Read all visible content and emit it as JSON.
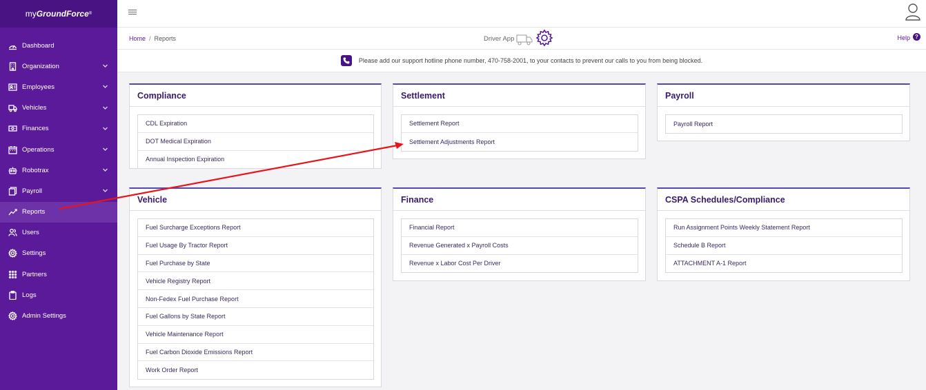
{
  "brand": {
    "part1": "my",
    "part2": "GroundForce",
    "mark": "®"
  },
  "sidebar": {
    "items": [
      {
        "label": "Dashboard",
        "icon": "dashboard-icon",
        "chevron": false
      },
      {
        "label": "Organization",
        "icon": "building-icon",
        "chevron": true
      },
      {
        "label": "Employees",
        "icon": "id-card-icon",
        "chevron": true
      },
      {
        "label": "Vehicles",
        "icon": "truck-icon",
        "chevron": true
      },
      {
        "label": "Finances",
        "icon": "money-icon",
        "chevron": true
      },
      {
        "label": "Operations",
        "icon": "calendar-icon",
        "chevron": true
      },
      {
        "label": "Robotrax",
        "icon": "robot-icon",
        "chevron": true
      },
      {
        "label": "Payroll",
        "icon": "payroll-icon",
        "chevron": true
      },
      {
        "label": "Reports",
        "icon": "chart-icon",
        "chevron": false,
        "active": true
      },
      {
        "label": "Users",
        "icon": "users-icon",
        "chevron": false
      },
      {
        "label": "Settings",
        "icon": "gear-icon",
        "chevron": false
      },
      {
        "label": "Partners",
        "icon": "grid-icon",
        "chevron": false
      },
      {
        "label": "Logs",
        "icon": "clipboard-icon",
        "chevron": false
      },
      {
        "label": "Admin Settings",
        "icon": "admin-gear-icon",
        "chevron": false
      }
    ]
  },
  "breadcrumb": {
    "home": "Home",
    "separator": "/",
    "current": "Reports"
  },
  "driver_app": {
    "label": "Driver App"
  },
  "help": {
    "label": "Help",
    "glyph": "?"
  },
  "notice": {
    "text": "Please add our support hotline phone number, 470-758-2001, to your contacts to prevent our calls to you from being blocked."
  },
  "cards": {
    "compliance": {
      "title": "Compliance",
      "items": [
        "CDL Expiration",
        "DOT Medical Expiration",
        "Annual Inspection Expiration"
      ]
    },
    "settlement": {
      "title": "Settlement",
      "items": [
        "Settlement Report",
        "Settlement Adjustments Report"
      ]
    },
    "payroll": {
      "title": "Payroll",
      "items": [
        "Payroll Report"
      ]
    },
    "vehicle": {
      "title": "Vehicle",
      "items": [
        "Fuel Surcharge Exceptions Report",
        "Fuel Usage By Tractor Report",
        "Fuel Purchase by State",
        "Vehicle Registry Report",
        "Non-Fedex Fuel Purchase Report",
        "Fuel Gallons by State Report",
        "Vehicle Maintenance Report",
        "Fuel Carbon Dioxide Emissions Report",
        "Work Order Report"
      ]
    },
    "finance": {
      "title": "Finance",
      "items": [
        "Financial Report",
        "Revenue Generated x Payroll Costs",
        "Revenue x Labor Cost Per Driver"
      ]
    },
    "cspa": {
      "title": "CSPA Schedules/Compliance",
      "items": [
        "Run Assignment Points Weekly Statement Report",
        "Schedule B Report",
        "ATTACHMENT A-1 Report"
      ]
    }
  },
  "colors": {
    "sidebar": "#5b1a99",
    "accent": "#5146b5",
    "annotation_arrow": "#e8141c"
  }
}
